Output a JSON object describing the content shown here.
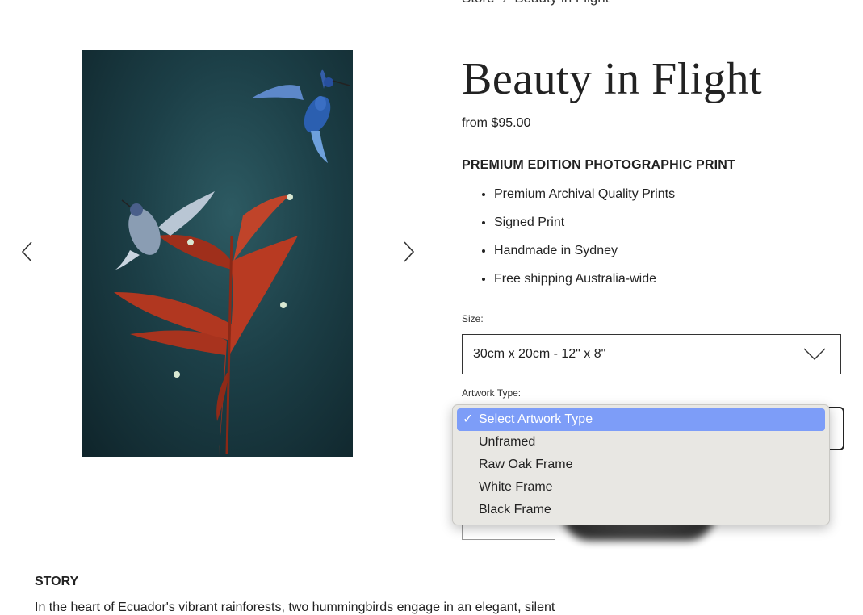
{
  "breadcrumb": {
    "parent": "Store",
    "separator": "›",
    "current": "Beauty in Flight"
  },
  "product": {
    "title": "Beauty in Flight",
    "price": "from $95.00",
    "edition_heading": "PREMIUM EDITION PHOTOGRAPHIC PRINT",
    "features": [
      "Premium Archival Quality Prints",
      "Signed Print",
      "Handmade in Sydney",
      "Free shipping Australia-wide"
    ]
  },
  "options": {
    "size_label": "Size:",
    "size_value": "30cm x 20cm - 12\" x 8\"",
    "artwork_label": "Artwork Type:",
    "artwork_options": [
      "Select Artwork Type",
      "Unframed",
      "Raw Oak Frame",
      "White Frame",
      "Black Frame"
    ],
    "artwork_selected_index": 0,
    "check_mark": "✓"
  },
  "quantity": {
    "plus": "+"
  },
  "story": {
    "heading": "STORY",
    "text": "In the heart of Ecuador's vibrant rainforests, two hummingbirds engage in an elegant, silent"
  },
  "icons": {
    "gallery_prev": "chevron-left-icon",
    "gallery_next": "chevron-right-icon",
    "select_chevron": "chevron-down-icon"
  },
  "colors": {
    "photo_background": "#1c3f47",
    "flower": "#b83a22",
    "dropdown_highlight": "#7d9df8",
    "dropdown_background": "#e8e7e3"
  }
}
